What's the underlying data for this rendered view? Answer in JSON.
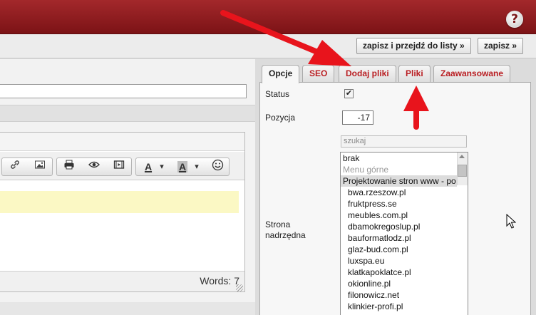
{
  "header": {
    "help_label": "?"
  },
  "actions": {
    "save_and_list": "zapisz i przejdź do listy »",
    "save": "zapisz »"
  },
  "editor": {
    "toolbar_icons": [
      "link-icon",
      "image-icon",
      "print-icon",
      "preview-icon",
      "media-icon",
      "text-color-icon",
      "background-color-icon",
      "emoticon-icon"
    ],
    "text_color_glyph": "A",
    "bg_color_glyph": "A",
    "dropdown_glyph": "▾",
    "words_label": "Words: 7"
  },
  "tabs": [
    {
      "label": "Opcje",
      "active": true
    },
    {
      "label": "SEO",
      "active": false
    },
    {
      "label": "Dodaj pliki",
      "active": false
    },
    {
      "label": "Pliki",
      "active": false
    },
    {
      "label": "Zaawansowane",
      "active": false
    }
  ],
  "form": {
    "status_label": "Status",
    "status_checked": true,
    "position_label": "Pozycja",
    "position_value": "-17",
    "search_placeholder": "szukaj",
    "parent_label_line1": "Strona",
    "parent_label_line2": "nadrzędna",
    "parent_options": [
      {
        "text": "brak",
        "style": "normal"
      },
      {
        "text": "Menu górne",
        "style": "grey"
      },
      {
        "text": "Projektowanie stron www - po",
        "style": "selected"
      },
      {
        "text": "bwa.rzeszow.pl",
        "style": "indent"
      },
      {
        "text": "fruktpress.se",
        "style": "indent"
      },
      {
        "text": "meubles.com.pl",
        "style": "indent"
      },
      {
        "text": "dbamokregoslup.pl",
        "style": "indent"
      },
      {
        "text": "bauformatlodz.pl",
        "style": "indent"
      },
      {
        "text": "glaz-bud.com.pl",
        "style": "indent"
      },
      {
        "text": "luxspa.eu",
        "style": "indent"
      },
      {
        "text": "klatkapoklatce.pl",
        "style": "indent"
      },
      {
        "text": "okionline.pl",
        "style": "indent"
      },
      {
        "text": "filonowicz.net",
        "style": "indent"
      },
      {
        "text": "klinkier-profi.pl",
        "style": "indent"
      }
    ]
  },
  "colors": {
    "header": "#8f1c1f",
    "tab_text": "#b91e22",
    "annotation_arrow": "#e8141c"
  }
}
